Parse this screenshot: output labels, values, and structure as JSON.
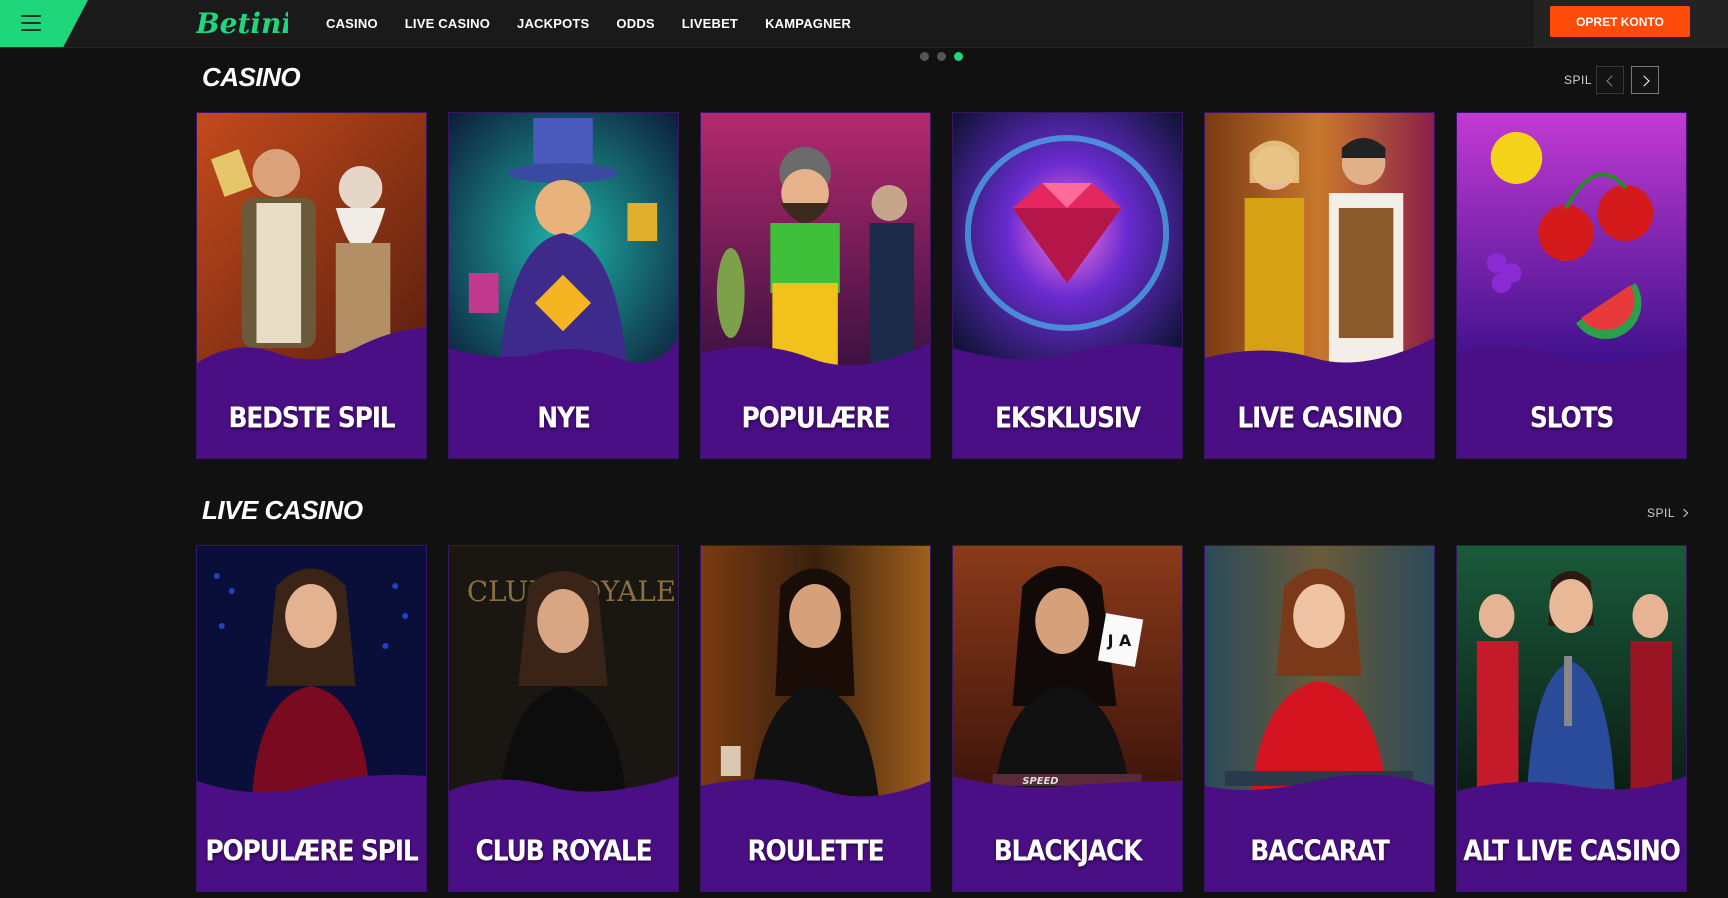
{
  "header": {
    "logo_text": "Betinia",
    "nav": [
      "CASINO",
      "LIVE CASINO",
      "JACKPOTS",
      "ODDS",
      "LIVEBET",
      "KAMPAGNER"
    ],
    "register_label": "OPRET KONTO"
  },
  "carousel": {
    "dots": 3,
    "active_index": 2
  },
  "sections": {
    "casino": {
      "title": "CASINO",
      "link": "SPIL",
      "cards": [
        "BEDSTE SPIL",
        "NYE",
        "POPULÆRE",
        "EKSKLUSIV",
        "LIVE CASINO",
        "SLOTS"
      ]
    },
    "live": {
      "title": "LIVE CASINO",
      "link": "SPIL",
      "cards": [
        "POPULÆRE SPIL",
        "CLUB ROYALE",
        "ROULETTE",
        "BLACKJACK",
        "BACCARAT",
        "ALT LIVE CASINO"
      ]
    }
  },
  "colors": {
    "brand_green": "#1fd67a",
    "cta_orange": "#ff4b0a",
    "card_purple": "#4b0f85",
    "background": "#111111"
  }
}
